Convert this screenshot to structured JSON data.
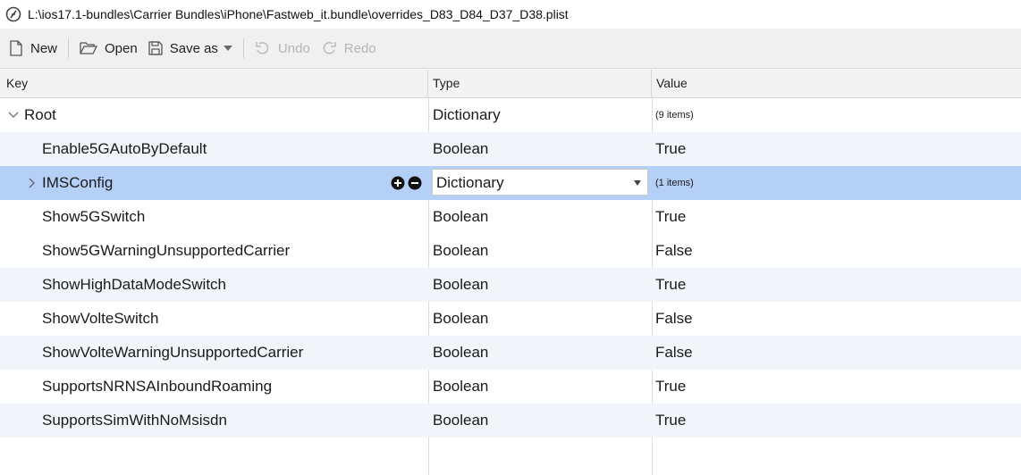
{
  "window": {
    "title": "L:\\ios17.1-bundles\\Carrier Bundles\\iPhone\\Fastweb_it.bundle\\overrides_D83_D84_D37_D38.plist"
  },
  "toolbar": {
    "new_label": "New",
    "open_label": "Open",
    "saveas_label": "Save as",
    "undo_label": "Undo",
    "redo_label": "Redo"
  },
  "columns": {
    "key": "Key",
    "type": "Type",
    "value": "Value"
  },
  "root": {
    "key": "Root",
    "type": "Dictionary",
    "value": "(9 items)"
  },
  "rows": [
    {
      "key": "Enable5GAutoByDefault",
      "type": "Boolean",
      "value": "True"
    },
    {
      "key": "IMSConfig",
      "type": "Dictionary",
      "value": "(1 items)"
    },
    {
      "key": "Show5GSwitch",
      "type": "Boolean",
      "value": "True"
    },
    {
      "key": "Show5GWarningUnsupportedCarrier",
      "type": "Boolean",
      "value": "False"
    },
    {
      "key": "ShowHighDataModeSwitch",
      "type": "Boolean",
      "value": "True"
    },
    {
      "key": "ShowVolteSwitch",
      "type": "Boolean",
      "value": "False"
    },
    {
      "key": "ShowVolteWarningUnsupportedCarrier",
      "type": "Boolean",
      "value": "False"
    },
    {
      "key": "SupportsNRNSAInboundRoaming",
      "type": "Boolean",
      "value": "True"
    },
    {
      "key": "SupportsSimWithNoMsisdn",
      "type": "Boolean",
      "value": "True"
    }
  ],
  "colors": {
    "selection": "#b5d0f7",
    "alt_row": "#f1f4f9"
  },
  "icons": [
    "app-icon",
    "new-file-icon",
    "folder-open-icon",
    "save-icon",
    "undo-icon",
    "redo-icon",
    "chevron-down-icon",
    "chevron-right-icon",
    "add-circle-icon",
    "remove-circle-icon"
  ]
}
